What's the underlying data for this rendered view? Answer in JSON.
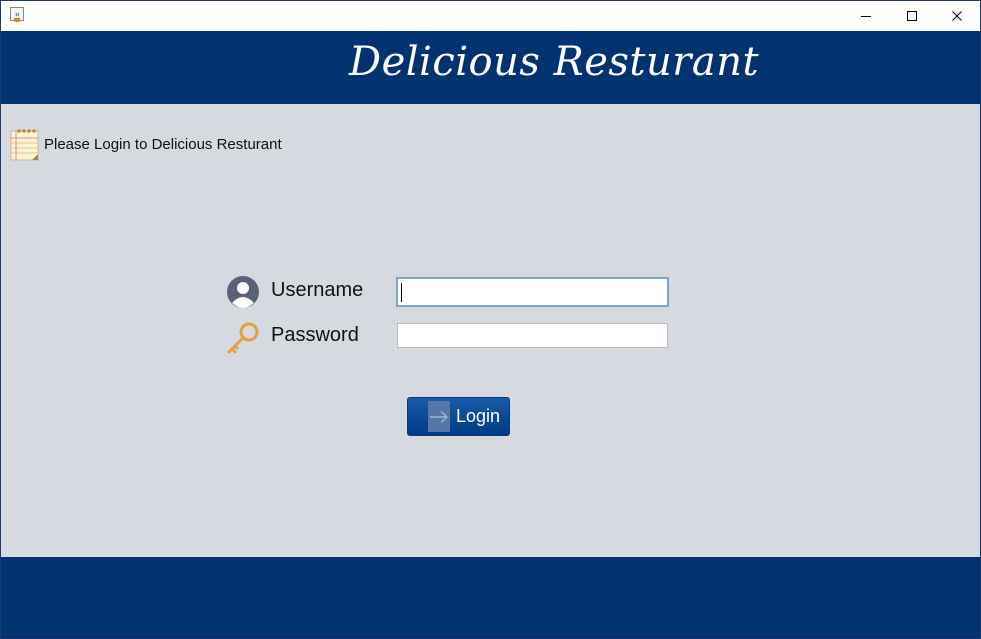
{
  "window": {
    "app_icon": "java-cup-icon",
    "controls": {
      "minimize": "minimize-icon",
      "maximize": "maximize-icon",
      "close": "close-icon"
    }
  },
  "header": {
    "title": "Delicious Resturant"
  },
  "prompt": {
    "icon": "notepad-icon",
    "text": "Please Login to Delicious Resturant"
  },
  "form": {
    "username": {
      "icon": "user-avatar-icon",
      "label": "Username",
      "value": ""
    },
    "password": {
      "icon": "key-icon",
      "label": "Password",
      "value": ""
    },
    "login_button": {
      "icon": "arrow-right-icon",
      "label": "Login"
    }
  },
  "colors": {
    "header_bg": "#00336f",
    "body_bg": "#d6d9df",
    "button_bg": "#003b84",
    "key_gold": "#e0a238",
    "avatar_slate": "#5a6278"
  }
}
